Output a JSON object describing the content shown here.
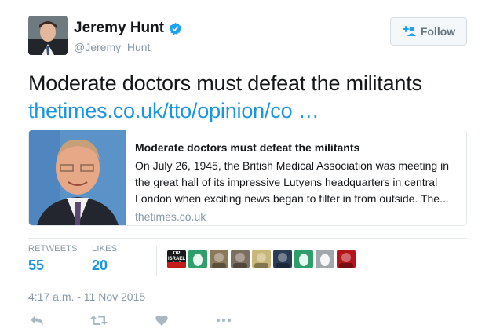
{
  "author": {
    "name": "Jeremy Hunt",
    "handle": "@Jeremy_Hunt",
    "verified": true
  },
  "follow_button": {
    "label": "Follow",
    "icon": "add-user-icon"
  },
  "tweet": {
    "text": "Moderate doctors must defeat the militants",
    "link_text": "thetimes.co.uk/tto/opinion/co …"
  },
  "card": {
    "title": "Moderate doctors must defeat the militants",
    "description": "On July 26, 1945, the British Medical Association was meeting in the great hall of its impressive Lutyens headquarters in central London when exciting news began to filter in from outside. The...",
    "domain": "thetimes.co.uk"
  },
  "stats": {
    "retweets_label": "RETWEETS",
    "retweets_count": "55",
    "likes_label": "LIKES",
    "likes_count": "20"
  },
  "liker_avatars": [
    {
      "label": "OP ISRAEL GAZ",
      "color": "#1a1a1a"
    },
    {
      "label": "",
      "color": "#2e9e6a"
    },
    {
      "label": "",
      "color": "#8a7a5a"
    },
    {
      "label": "",
      "color": "#7d6e62"
    },
    {
      "label": "",
      "color": "#c8b67a"
    },
    {
      "label": "",
      "color": "#2b3d55"
    },
    {
      "label": "",
      "color": "#2e9e6a"
    },
    {
      "label": "",
      "color": "#a0a7ad"
    },
    {
      "label": "",
      "color": "#b5141b"
    }
  ],
  "timestamp": "4:17 a.m. - 11 Nov 2015",
  "actions": [
    "reply-icon",
    "retweet-icon",
    "like-icon",
    "more-icon"
  ],
  "colors": {
    "link": "#1b95e0",
    "muted": "#8899a6",
    "border": "#e1e8ed",
    "verified": "#1da1f2"
  }
}
